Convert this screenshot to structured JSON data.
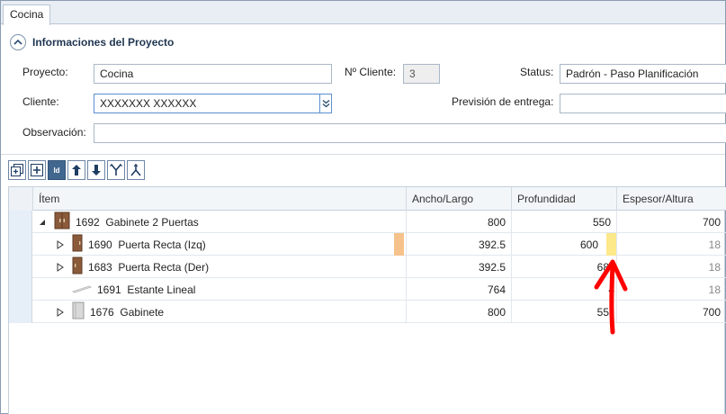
{
  "tab": {
    "label": "Cocina"
  },
  "section": {
    "title": "Informaciones del Proyecto"
  },
  "form": {
    "proyecto_label": "Proyecto:",
    "proyecto_value": "Cocina",
    "ncliente_label": "Nº Cliente:",
    "ncliente_value": "3",
    "status_label": "Status:",
    "status_value": "Padrón - Paso Planificación",
    "cliente_label": "Cliente:",
    "cliente_value": "XXXXXXX XXXXXX",
    "prevision_label": "Previsión de entrega:",
    "prevision_value": "",
    "observacion_label": "Observación:",
    "observacion_value": ""
  },
  "toolbar": {
    "buttons": [
      "expand-all",
      "add",
      "id",
      "move-up",
      "move-down",
      "merge",
      "split"
    ],
    "id_label": "Id"
  },
  "grid": {
    "headers": {
      "item": "Ítem",
      "ancho": "Ancho/Largo",
      "profundidad": "Profundidad",
      "espesor": "Espesor/Altura"
    },
    "rows": [
      {
        "id": "1692",
        "name": "Gabinete 2 Puertas",
        "ancho": "800",
        "prof": "550",
        "espesor": "700"
      },
      {
        "id": "1690",
        "name": "Puerta Recta (Izq)",
        "ancho": "392.5",
        "prof": "600",
        "espesor": "18"
      },
      {
        "id": "1683",
        "name": "Puerta Recta (Der)",
        "ancho": "392.5",
        "prof": "68",
        "espesor": "18"
      },
      {
        "id": "1691",
        "name": "Estante Lineal",
        "ancho": "764",
        "prof": "4",
        "espesor": "18"
      },
      {
        "id": "1676",
        "name": "Gabinete",
        "ancho": "800",
        "prof": "55",
        "espesor": "700"
      }
    ]
  },
  "colors": {
    "accent": "#41678f",
    "warning_orange": "#f6c28b",
    "warning_yellow": "#fde88a",
    "annotation_red": "#ff0000"
  }
}
